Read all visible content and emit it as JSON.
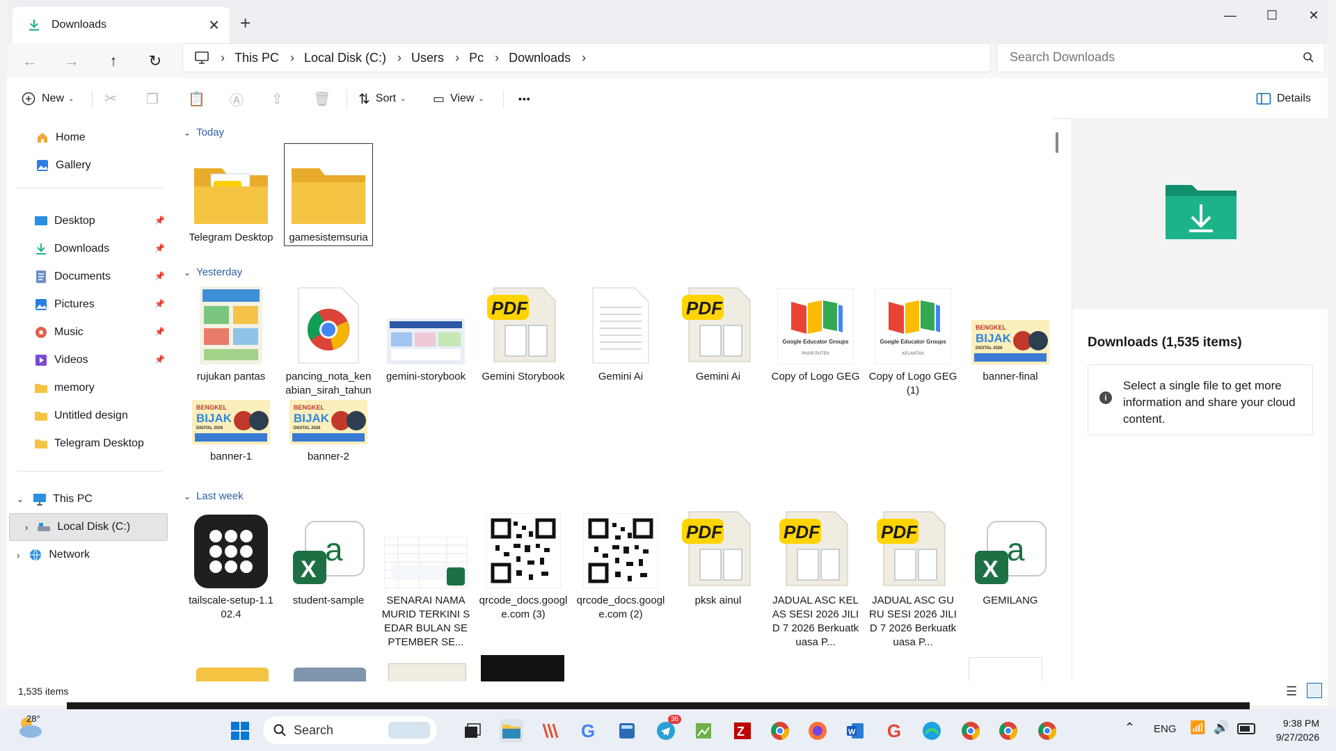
{
  "window": {
    "tab_title": "Downloads",
    "tab_close": "✕",
    "new_tab": "+",
    "controls": {
      "minimize": "—",
      "maximize": "☐",
      "close": "✕"
    }
  },
  "address": {
    "crumbs": [
      "This PC",
      "Local Disk (C:)",
      "Users",
      "Pc",
      "Downloads"
    ],
    "search_placeholder": "Search Downloads"
  },
  "toolbar": {
    "new": "New",
    "sort": "Sort",
    "view": "View",
    "more": "•••",
    "details": "Details"
  },
  "sidebar": {
    "home": "Home",
    "gallery": "Gallery",
    "quick": [
      "Desktop",
      "Downloads",
      "Documents",
      "Pictures",
      "Music",
      "Videos",
      "memory",
      "Untitled design",
      "Telegram Desktop"
    ],
    "this_pc": "This PC",
    "local_disk": "Local Disk (C:)",
    "network": "Network"
  },
  "groups": {
    "today": "Today",
    "yesterday": "Yesterday",
    "last_week": "Last week"
  },
  "files": {
    "today": [
      "Telegram Desktop",
      "gamesistemsuria"
    ],
    "yesterday": [
      "rujukan pantas",
      "pancing_nota_kenabian_sirah_tahun_3",
      "gemini-storybook",
      "Gemini Storybook",
      "Gemini Ai",
      "Gemini Ai",
      "Copy of Logo GEG",
      "Copy of Logo GEG (1)",
      "banner-final",
      "banner-1",
      "banner-2"
    ],
    "last_week": [
      "tailscale-setup-1.102.4",
      "student-sample",
      "SENARAI NAMA MURID TERKINI SEDAR BULAN SEPTEMBER SE...",
      "qrcode_docs.google.com (3)",
      "qrcode_docs.google.com (2)",
      "pksk ainul",
      "JADUAL ASC KELAS SESI 2026 JILID 7  2026 Berkuatkuasa P...",
      "JADUAL ASC GURU SESI 2026 JILID 7  2026 Berkuatkuasa P...",
      "GEMILANG"
    ]
  },
  "thumb_text": {
    "pdf": "PDF",
    "geg_title": "Google Educator Groups",
    "geg_sub1": "PASIR PUTEH",
    "geg_sub2": "KELANTAN",
    "banner_small": "BENGKEL",
    "banner_big": "BIJAK",
    "banner_digital": "DIGITAL 2026"
  },
  "details": {
    "title": "Downloads (1,535 items)",
    "info": "Select a single file to get more information and share your cloud content."
  },
  "status": {
    "items": "1,535 items"
  },
  "taskbar": {
    "weather_temp": "28°",
    "search": "Search",
    "telegram_badge": "36",
    "lang": "ENG",
    "time": "9:38 PM",
    "date": "9/27/2026"
  },
  "colors": {
    "accent": "#0067c0",
    "folder": "#f5c342",
    "green": "#1db38a"
  }
}
